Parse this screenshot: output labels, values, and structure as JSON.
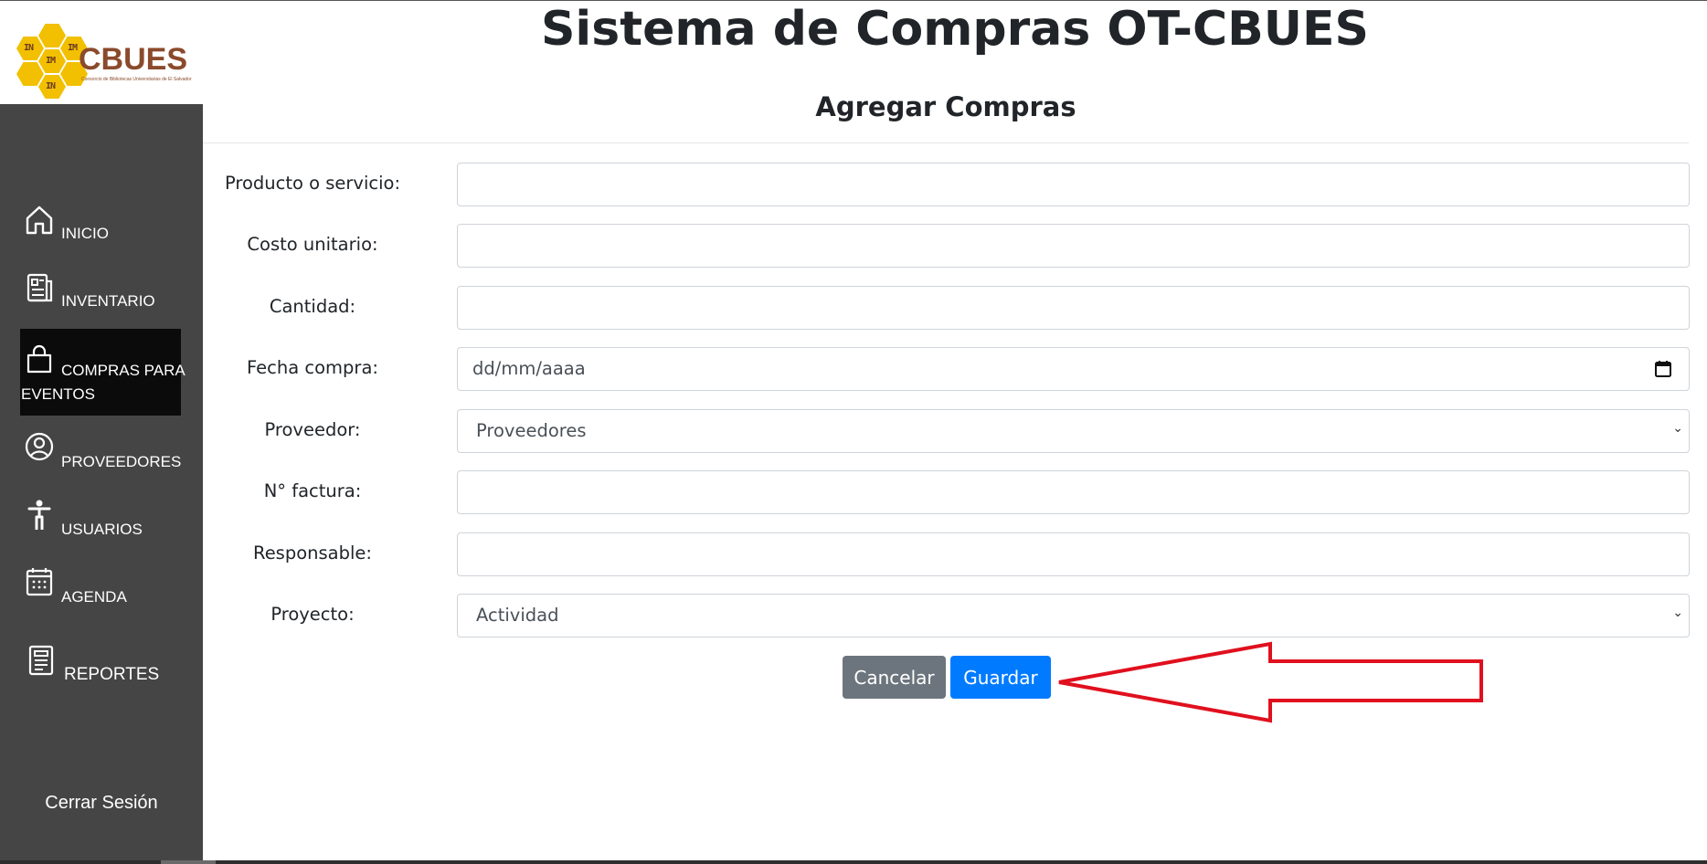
{
  "app": {
    "title": "Sistema de Compras OT-CBUES",
    "logo_text": "CBUES",
    "logo_tagline": "Consorcio de Bibliotecas Universitarias de El Salvador"
  },
  "sidebar": {
    "items": [
      {
        "label": "INICIO",
        "icon": "home-icon"
      },
      {
        "label": "INVENTARIO",
        "icon": "newspaper-icon"
      },
      {
        "label": "COMPRAS PARA",
        "label2": "EVENTOS",
        "icon": "shopping-bag-icon",
        "active": true
      },
      {
        "label": "PROVEEDORES",
        "icon": "person-circle-icon"
      },
      {
        "label": "USUARIOS",
        "icon": "person-standing-icon"
      },
      {
        "label": "AGENDA",
        "icon": "calendar-icon"
      },
      {
        "label": "REPORTES",
        "icon": "report-icon"
      }
    ],
    "logout": "Cerrar Sesión"
  },
  "form": {
    "heading": "Agregar Compras",
    "fields": {
      "producto": {
        "label": "Producto o servicio:",
        "value": ""
      },
      "costo": {
        "label": "Costo unitario:",
        "value": ""
      },
      "cantidad": {
        "label": "Cantidad:",
        "value": ""
      },
      "fecha": {
        "label": "Fecha compra:",
        "placeholder": "dd/mm/aaaa"
      },
      "proveedor": {
        "label": "Proveedor:",
        "selected": "Proveedores"
      },
      "factura": {
        "label": "N° factura:",
        "value": ""
      },
      "responsable": {
        "label": "Responsable:",
        "value": ""
      },
      "proyecto": {
        "label": "Proyecto:",
        "selected": "Actividad"
      }
    },
    "buttons": {
      "cancel": "Cancelar",
      "save": "Guardar"
    }
  },
  "colors": {
    "sidebar_bg": "#454545",
    "sidebar_active": "#0b0b0b",
    "primary": "#007bff",
    "secondary": "#6c757d",
    "annotation_arrow": "#e0101e"
  }
}
